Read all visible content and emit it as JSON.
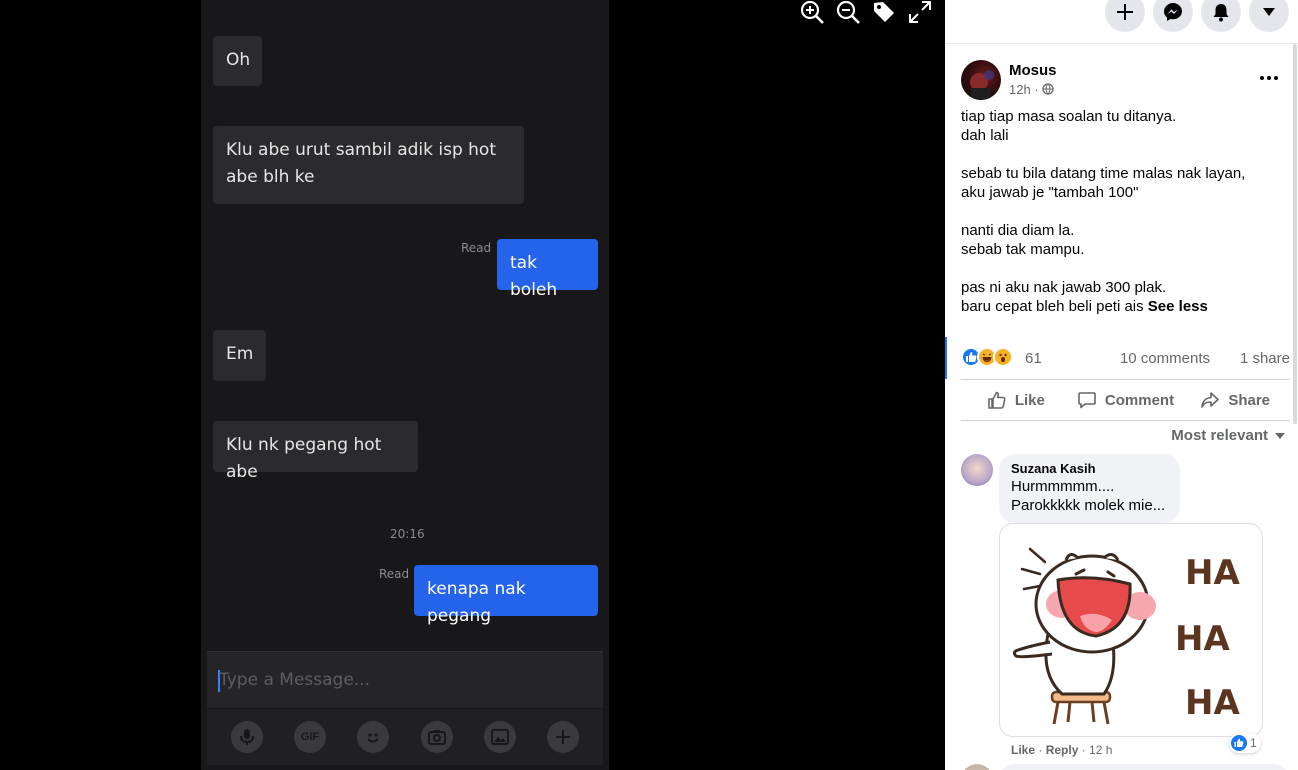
{
  "viewer": {
    "controls": [
      "zoom-in-icon",
      "zoom-out-icon",
      "tag-icon",
      "fullscreen-icon"
    ]
  },
  "chat": {
    "messages": [
      {
        "dir": "in",
        "text": "Oh"
      },
      {
        "dir": "in",
        "text": "Klu abe urut sambil adik isp hot abe blh ke"
      },
      {
        "dir": "out",
        "status": "Read",
        "text": "tak boleh"
      },
      {
        "dir": "in",
        "text": "Em"
      },
      {
        "dir": "in",
        "text": "Klu nk pegang hot abe"
      },
      {
        "dir": "out",
        "status": "Read",
        "text": "kenapa nak pegang"
      }
    ],
    "timestamp": "20:16",
    "input_placeholder": "Type a Message...",
    "tools": [
      "mic-icon",
      "GIF",
      "emoji-icon",
      "camera-icon",
      "image-icon",
      "plus-icon"
    ],
    "gif_label": "GIF"
  },
  "facebook": {
    "topbar": [
      "plus-icon",
      "messenger-icon",
      "bell-icon",
      "caret-down-icon"
    ],
    "post": {
      "author": "Mosus",
      "time": "12h ·",
      "paragraphs": [
        "tiap tiap masa soalan tu ditanya.\ndah lali",
        "sebab tu bila datang time malas nak layan,\naku jawab je \"tambah 100\"",
        "nanti dia diam la.\nsebab tak mampu.",
        "pas ni aku nak jawab 300 plak.\nbaru cepat bleh beli peti ais"
      ],
      "see_less": "See less",
      "reaction_count": "61",
      "comment_count": "10 comments",
      "share_count": "1 share",
      "actions": {
        "like": "Like",
        "comment": "Comment",
        "share": "Share"
      },
      "sort_label": "Most relevant"
    },
    "comment": {
      "name": "Suzana Kasih",
      "line1": "Hurmmmmm....",
      "line2": "Parokkkkk molek mie...",
      "sticker_text": "HA HA HA",
      "like_label": "Like",
      "reply_label": "Reply",
      "age": "12 h",
      "likes": "1"
    },
    "colors": {
      "accent": "#1877f2",
      "outgoing_bubble": "#2563eb"
    }
  }
}
